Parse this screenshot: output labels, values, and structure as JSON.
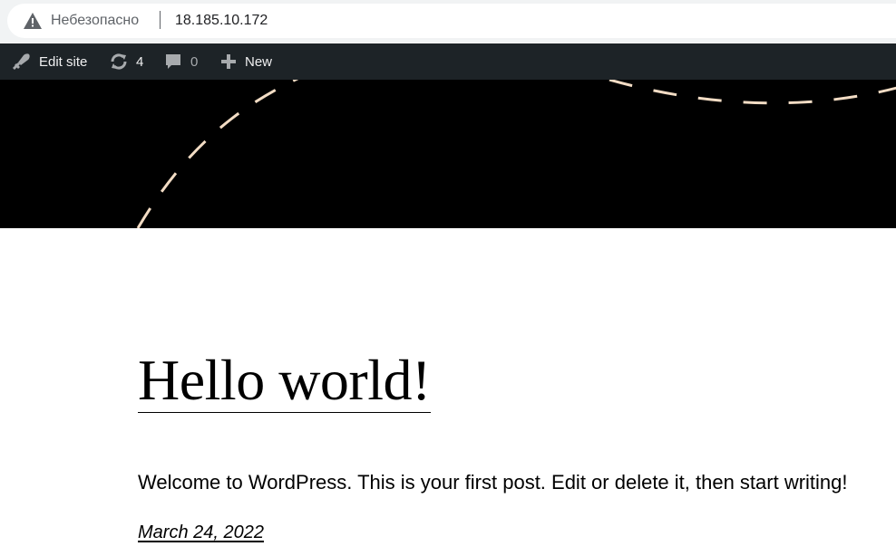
{
  "browser": {
    "security_label": "Небезопасно",
    "url": "18.185.10.172"
  },
  "adminbar": {
    "edit_site_label": "Edit site",
    "updates_count": "4",
    "comments_count": "0",
    "new_label": "New"
  },
  "post": {
    "title": "Hello world!",
    "body": "Welcome to WordPress. This is your first post. Edit or delete it, then start writing!",
    "date": "March 24, 2022"
  },
  "colors": {
    "adminbar_bg": "#1d2327",
    "banner_bg": "#000000",
    "dash_stroke": "#f2dcc4"
  }
}
